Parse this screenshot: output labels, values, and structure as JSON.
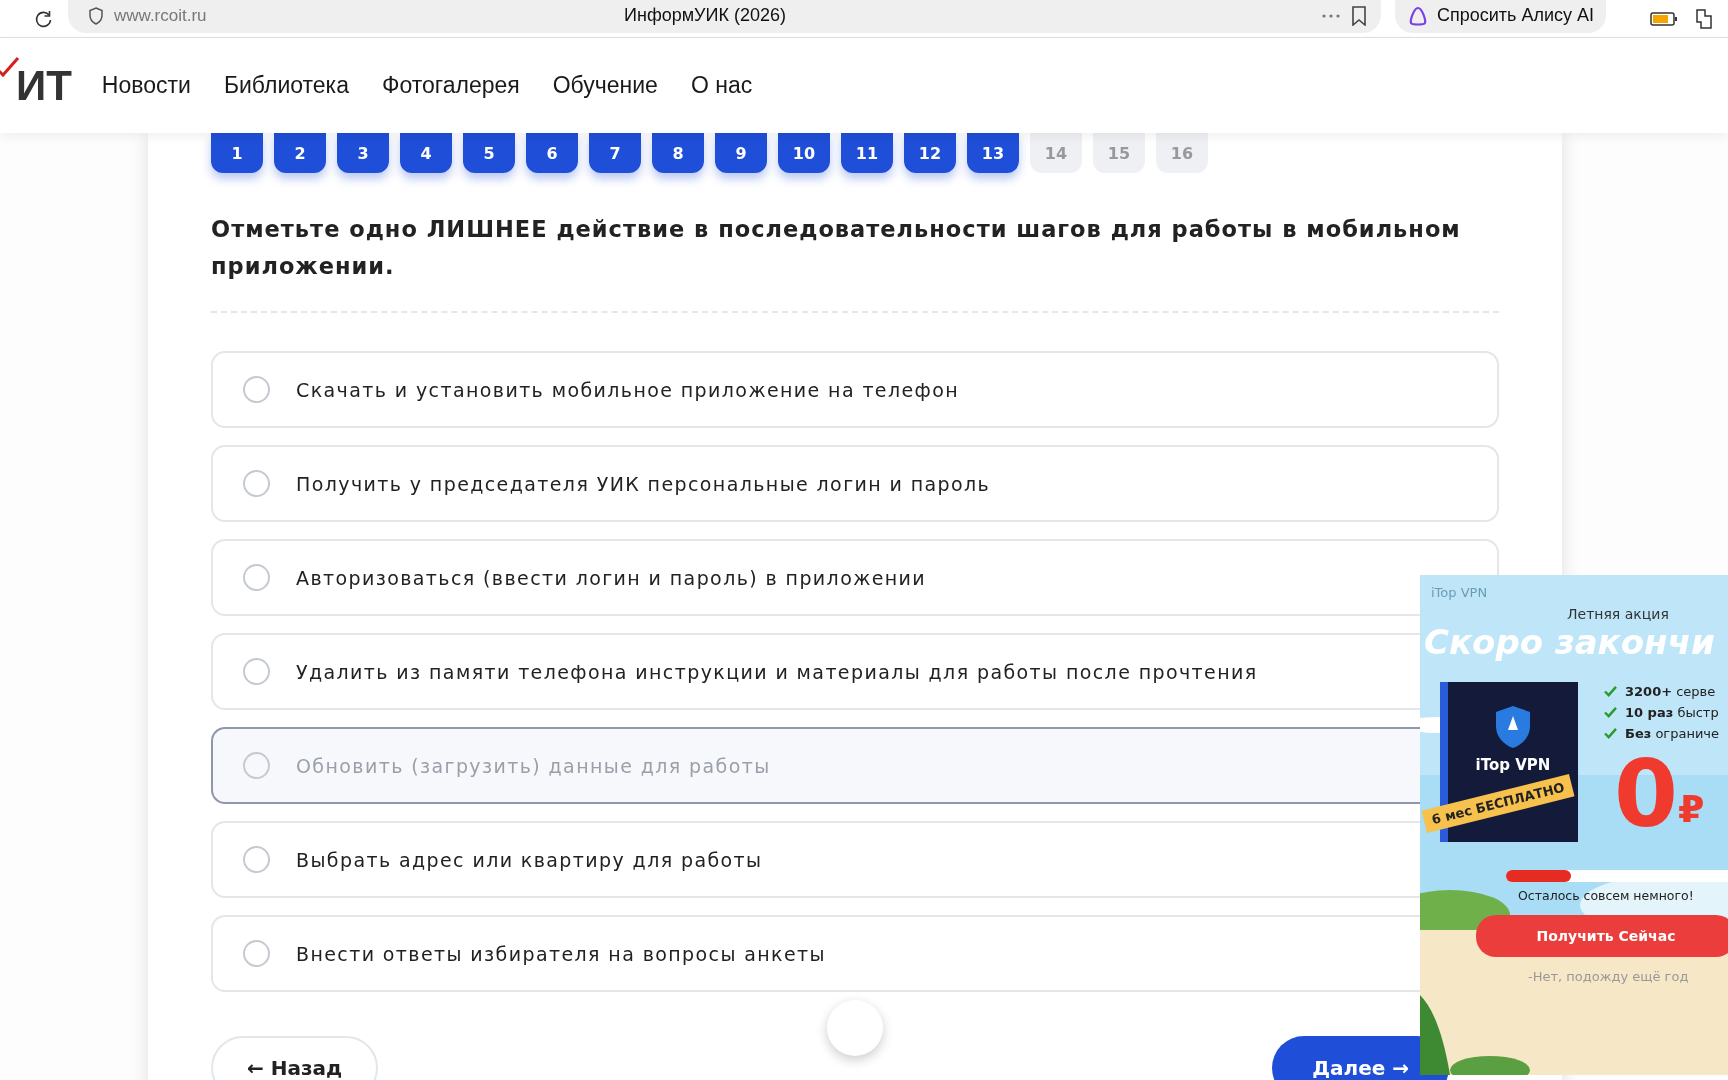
{
  "browser": {
    "url": "www.rcoit.ru",
    "title": "ИнформУИК (2026)",
    "assistant": "Спросить Алису AI"
  },
  "site": {
    "logo": "ИТ",
    "nav": [
      "Новости",
      "Библиотека",
      "Фотогалерея",
      "Обучение",
      "О нас"
    ]
  },
  "pager": [
    {
      "label": "1",
      "answered": true
    },
    {
      "label": "2",
      "answered": true
    },
    {
      "label": "3",
      "answered": true
    },
    {
      "label": "4",
      "answered": true
    },
    {
      "label": "5",
      "answered": true
    },
    {
      "label": "6",
      "answered": true
    },
    {
      "label": "7",
      "answered": true
    },
    {
      "label": "8",
      "answered": true
    },
    {
      "label": "9",
      "answered": true
    },
    {
      "label": "10",
      "answered": true
    },
    {
      "label": "11",
      "answered": true
    },
    {
      "label": "12",
      "answered": true
    },
    {
      "label": "13",
      "answered": true
    },
    {
      "label": "14",
      "answered": false
    },
    {
      "label": "15",
      "answered": false
    },
    {
      "label": "16",
      "answered": false
    }
  ],
  "question": "Отметьте одно ЛИШНЕЕ действие в последовательности шагов для работы в мобильном приложении.",
  "options": [
    {
      "text": "Скачать и установить мобильное приложение на телефон",
      "selected": false,
      "hovered": false
    },
    {
      "text": "Получить у председателя УИК персональные логин и пароль",
      "selected": false,
      "hovered": false
    },
    {
      "text": "Авторизоваться (ввести логин и пароль) в приложении",
      "selected": false,
      "hovered": false
    },
    {
      "text": "Удалить из памяти телефона инструкции и материалы для работы после прочтения",
      "selected": false,
      "hovered": false
    },
    {
      "text": "Обновить (загрузить) данные для работы",
      "selected": false,
      "hovered": true
    },
    {
      "text": "Выбрать адрес или квартиру для работы",
      "selected": false,
      "hovered": false
    },
    {
      "text": "Внести ответы избирателя на вопросы анкеты",
      "selected": false,
      "hovered": false
    }
  ],
  "buttons": {
    "back": "← Назад",
    "next": "Далее →"
  },
  "ad": {
    "brand": "iTop VPN",
    "kicker": "Летняя акция",
    "headline": "Скоро закончи",
    "features": [
      "**3200+** серве",
      "**10 раз** быстр",
      "**Без** ограниче"
    ],
    "box_title": "iTop VPN",
    "ribbon": "6 мес БЕСПЛАТНО",
    "price": "0",
    "currency": "₽",
    "progress": {
      "level": 0.27,
      "caption": "Осталось совсем немного!"
    },
    "cta": "Получить Сейчас",
    "decline": "-Нет, подожду ещё год"
  }
}
